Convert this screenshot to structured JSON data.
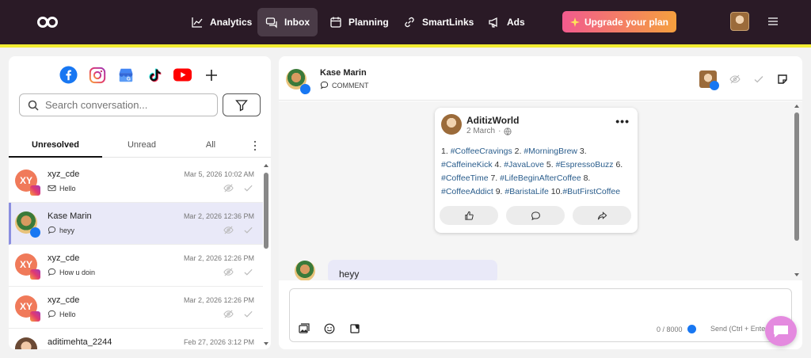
{
  "nav": {
    "items": [
      {
        "label": "Analytics",
        "icon": "chart-line-icon"
      },
      {
        "label": "Inbox",
        "icon": "inbox-icon",
        "active": true
      },
      {
        "label": "Planning",
        "icon": "calendar-icon"
      },
      {
        "label": "SmartLinks",
        "icon": "link-icon"
      },
      {
        "label": "Ads",
        "icon": "megaphone-icon"
      }
    ],
    "upgrade_label": "Upgrade your plan"
  },
  "left": {
    "networks": [
      "facebook-icon",
      "instagram-icon",
      "google-business-icon",
      "tiktok-icon",
      "youtube-icon",
      "plus-icon"
    ],
    "search_placeholder": "Search conversation...",
    "tabs": [
      {
        "label": "Unresolved",
        "active": true
      },
      {
        "label": "Unread",
        "active": false
      },
      {
        "label": "All",
        "active": false
      }
    ],
    "conversations": [
      {
        "name": "xyz_cde",
        "initials": "XY",
        "network": "instagram",
        "date": "Mar 5, 2026 10:02 AM",
        "type": "message",
        "text": "Hello",
        "selected": false
      },
      {
        "name": "Kase Marin",
        "initials": "",
        "network": "facebook",
        "date": "Mar 2, 2026 12:36 PM",
        "type": "comment",
        "text": "heyy",
        "selected": true
      },
      {
        "name": "xyz_cde",
        "initials": "XY",
        "network": "instagram",
        "date": "Mar 2, 2026 12:26 PM",
        "type": "comment",
        "text": "How u doin",
        "selected": false
      },
      {
        "name": "xyz_cde",
        "initials": "XY",
        "network": "instagram",
        "date": "Mar 2, 2026 12:26 PM",
        "type": "comment",
        "text": "Hello",
        "selected": false
      },
      {
        "name": "aditimehta_2244",
        "initials": "",
        "network": "instagram",
        "date": "Feb 27, 2026 3:12 PM",
        "type": "comment",
        "text": "",
        "selected": false
      }
    ]
  },
  "right": {
    "contact_name": "Kase Marin",
    "contact_type": "COMMENT",
    "post": {
      "author": "AditizWorld",
      "date": "2 March",
      "text_parts": [
        {
          "t": "1. ",
          "tag": false
        },
        {
          "t": "#CoffeeCravings",
          "tag": true
        },
        {
          "t": " 2. ",
          "tag": false
        },
        {
          "t": "#MorningBrew",
          "tag": true
        },
        {
          "t": " 3. ",
          "tag": false
        },
        {
          "t": "#CaffeineKick",
          "tag": true
        },
        {
          "t": " 4. ",
          "tag": false
        },
        {
          "t": "#JavaLove",
          "tag": true
        },
        {
          "t": " 5. ",
          "tag": false
        },
        {
          "t": "#EspressoBuzz",
          "tag": true
        },
        {
          "t": " 6. ",
          "tag": false
        },
        {
          "t": "#CoffeeTime",
          "tag": true
        },
        {
          "t": " 7. ",
          "tag": false
        },
        {
          "t": "#LifeBeginAfterCoffee",
          "tag": true
        },
        {
          "t": " 8. ",
          "tag": false
        },
        {
          "t": "#CoffeeAddict",
          "tag": true
        },
        {
          "t": " 9. ",
          "tag": false
        },
        {
          "t": "#BaristaLife",
          "tag": true
        },
        {
          "t": " 10.",
          "tag": false
        },
        {
          "t": "#ButFirstCoffee",
          "tag": true
        }
      ]
    },
    "message": "heyy",
    "composer": {
      "char_count": "0 / 8000",
      "send_label": "Send (Ctrl + Enter)"
    }
  },
  "colors": {
    "topbar": "#2a1a26",
    "accent_line": "#f2ec32",
    "selected_row": "#e9e9f8",
    "hashtag": "#2a5d8c"
  }
}
